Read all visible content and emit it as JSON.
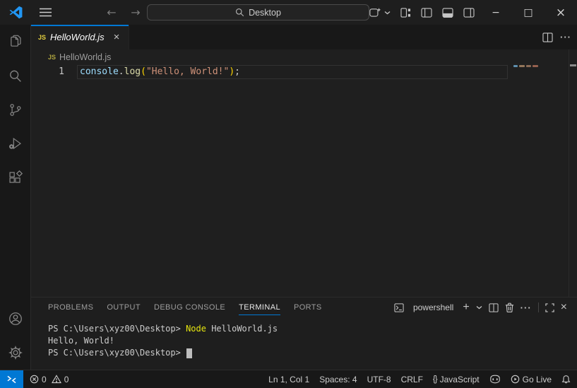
{
  "title_bar": {
    "command_center_value": "Desktop",
    "back_arrow": "←",
    "forward_arrow": "→"
  },
  "icons": {
    "minimize": "−",
    "maximize": "□",
    "close": "×",
    "ellipsis": "···",
    "plus": "+"
  },
  "tab": {
    "file_icon": "JS",
    "title": "HelloWorld.js"
  },
  "breadcrumb": {
    "file_icon": "JS",
    "title": "HelloWorld.js"
  },
  "editor": {
    "line_number": "1",
    "tokens": [
      {
        "text": "console",
        "color": "#9CDCFE"
      },
      {
        "text": ".",
        "color": "#CCCCCC"
      },
      {
        "text": "log",
        "color": "#DCDCAA"
      },
      {
        "text": "(",
        "color": "#FFD700"
      },
      {
        "text": "\"Hello, World!\"",
        "color": "#CE9178"
      },
      {
        "text": ")",
        "color": "#FFD700"
      },
      {
        "text": ";",
        "color": "#CCCCCC"
      }
    ]
  },
  "panel": {
    "tabs": [
      "PROBLEMS",
      "OUTPUT",
      "DEBUG CONSOLE",
      "TERMINAL",
      "PORTS"
    ],
    "active_tab": "TERMINAL",
    "shell_label": "powershell"
  },
  "terminal": {
    "lines": [
      {
        "prompt": "PS C:\\Users\\xyz00\\Desktop> ",
        "command": "Node",
        "args": " HelloWorld.js"
      },
      {
        "output": "Hello, World!"
      },
      {
        "prompt": "PS C:\\Users\\xyz00\\Desktop> "
      }
    ]
  },
  "status_bar": {
    "errors": "0",
    "warnings": "0",
    "cursor_position": "Ln 1, Col 1",
    "indentation": "Spaces: 4",
    "encoding": "UTF-8",
    "eol": "CRLF",
    "language_icon": "{}",
    "language": "JavaScript",
    "go_live": "Go Live"
  },
  "colors": {
    "accent_blue": "#0078d4",
    "chrome_bg": "#181818",
    "editor_bg": "#1f1f1f",
    "remote_indicator_bg": "#0078d4",
    "js_icon_yellow": "#e6d13f",
    "terminal_command_yellow": "#e5e510",
    "token_variable": "#9CDCFE",
    "token_function": "#DCDCAA",
    "token_string": "#CE9178",
    "token_bracket": "#FFD700"
  }
}
